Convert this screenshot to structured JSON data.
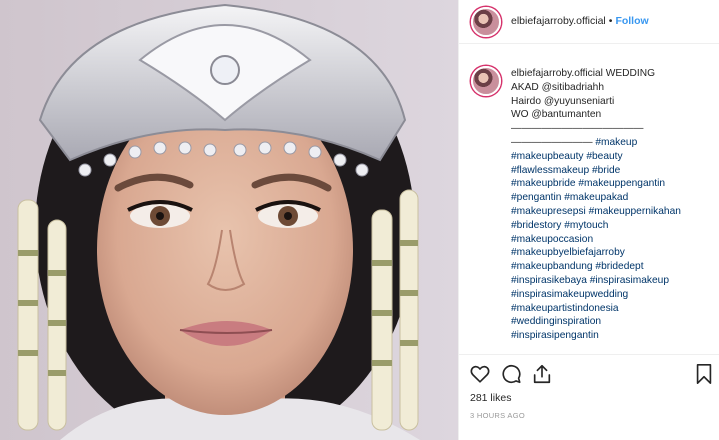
{
  "post": {
    "username": "elbiefajarroby.official",
    "separator": "•",
    "follow_label": "Follow",
    "caption_lines": [
      {
        "user": "elbiefajarroby.official",
        "text": " WEDDING"
      },
      {
        "text": "AKAD @sitibadriahh"
      },
      {
        "text": "Hairdo @yuyunseniarti"
      },
      {
        "text": "WO @bantumanten"
      },
      {
        "text": "—————————————"
      },
      {
        "text": "————————",
        "tag": " #makeup"
      },
      {
        "tag": "#makeupbeauty #beauty"
      },
      {
        "tag": "#flawlessmakeup #bride"
      },
      {
        "tag": "#makeupbride #makeuppengantin"
      },
      {
        "tag": "#pengantin #makeupakad"
      },
      {
        "tag": "#makeupresepsi #makeuppernikahan"
      },
      {
        "tag": "#bridestory #mytouch"
      },
      {
        "tag": "#makeupoccasion"
      },
      {
        "tag": "#makeupbyelbiefajarroby"
      },
      {
        "tag": "#makeupbandung #bridedept"
      },
      {
        "tag": "#inspirasikebaya #inspirasimakeup"
      },
      {
        "tag": "#inspirasimakeupwedding"
      },
      {
        "tag": "#makeupartistindonesia"
      },
      {
        "tag": "#weddinginspiration"
      },
      {
        "tag": "#inspirasipengantin"
      }
    ],
    "likes_label": "281 likes",
    "timestamp": "3 HOURS AGO"
  },
  "colors": {
    "link": "#003569",
    "follow": "#3897f0",
    "text": "#262626",
    "muted": "#999999",
    "avatar_ring": "#d6336c"
  },
  "icons": [
    "heart-icon",
    "comment-icon",
    "share-icon",
    "bookmark-icon"
  ]
}
